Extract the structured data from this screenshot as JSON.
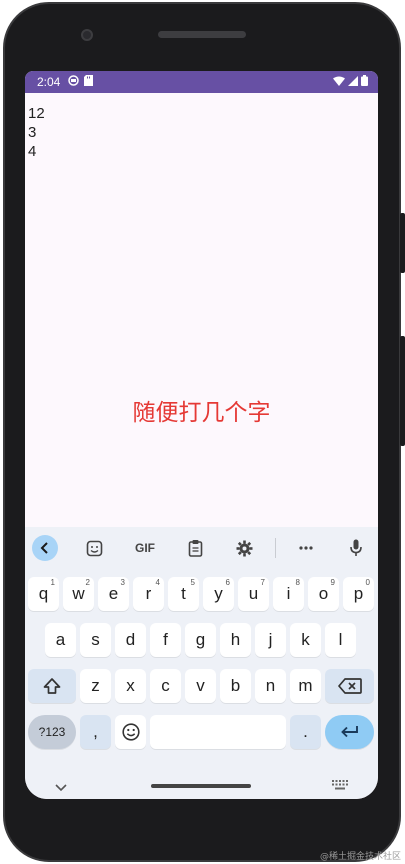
{
  "status_bar": {
    "time": "2:04"
  },
  "list_items": [
    "12",
    "3",
    "4"
  ],
  "center_text": "随便打几个字",
  "keyboard": {
    "toolbar": {
      "gif_label": "GIF"
    },
    "row1": [
      {
        "key": "q",
        "hint": "1"
      },
      {
        "key": "w",
        "hint": "2"
      },
      {
        "key": "e",
        "hint": "3"
      },
      {
        "key": "r",
        "hint": "4"
      },
      {
        "key": "t",
        "hint": "5"
      },
      {
        "key": "y",
        "hint": "6"
      },
      {
        "key": "u",
        "hint": "7"
      },
      {
        "key": "i",
        "hint": "8"
      },
      {
        "key": "o",
        "hint": "9"
      },
      {
        "key": "p",
        "hint": "0"
      }
    ],
    "row2": [
      "a",
      "s",
      "d",
      "f",
      "g",
      "h",
      "j",
      "k",
      "l"
    ],
    "row3": [
      "z",
      "x",
      "c",
      "v",
      "b",
      "n",
      "m"
    ],
    "num_switch": "?123",
    "comma": ",",
    "period": "."
  },
  "watermark": "@稀土掘金技术社区",
  "colors": {
    "status_bar": "#6750a4",
    "accent_text": "#e53935",
    "keyboard_bg": "#eef1f7"
  }
}
